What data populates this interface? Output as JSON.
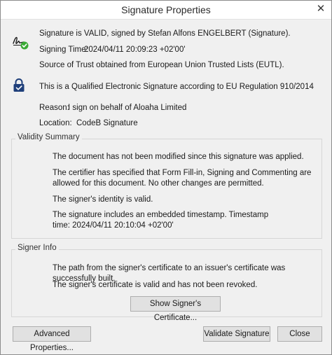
{
  "window": {
    "title": "Signature Properties"
  },
  "signature": {
    "status_text": "Signature is VALID, signed by Stefan Alfons ENGELBERT (Signature).",
    "signing_time_label": "Signing Time:",
    "signing_time_value": "2024/04/11 20:09:23 +02'00'",
    "trust_source": "Source of Trust obtained from European Union Trusted Lists (EUTL).",
    "qualified_text": "This is a Qualified Electronic Signature according to EU Regulation 910/2014",
    "reason_label": "Reason:",
    "reason_value": "I sign on behalf of Aloaha Limited",
    "location_label": "Location:",
    "location_value": "CodeB Signature"
  },
  "validity_summary": {
    "label": "Validity Summary",
    "items": [
      "The document has not been modified since this signature was applied.",
      "The certifier has specified that Form Fill-in, Signing and Commenting are allowed for this document. No other changes are permitted.",
      "The signer's identity is valid.",
      "The signature includes an embedded timestamp. Timestamp time: 2024/04/11 20:10:04 +02'00'"
    ]
  },
  "signer_info": {
    "label": "Signer Info",
    "items": [
      "The path from the signer's certificate to an issuer's certificate was successfully built.",
      "The signer's certificate is valid and has not been revoked."
    ],
    "show_certificate_button": "Show Signer's Certificate..."
  },
  "buttons": {
    "advanced_properties": "Advanced Properties...",
    "validate_signature": "Validate Signature",
    "close": "Close"
  },
  "colors": {
    "check_green": "#3aaa35",
    "lock_navy": "#1f3f7a",
    "dialog_bg": "#f0f0f0"
  },
  "icons": {
    "valid": "signature-valid-icon",
    "qualified": "lock-icon",
    "close": "close-icon"
  }
}
